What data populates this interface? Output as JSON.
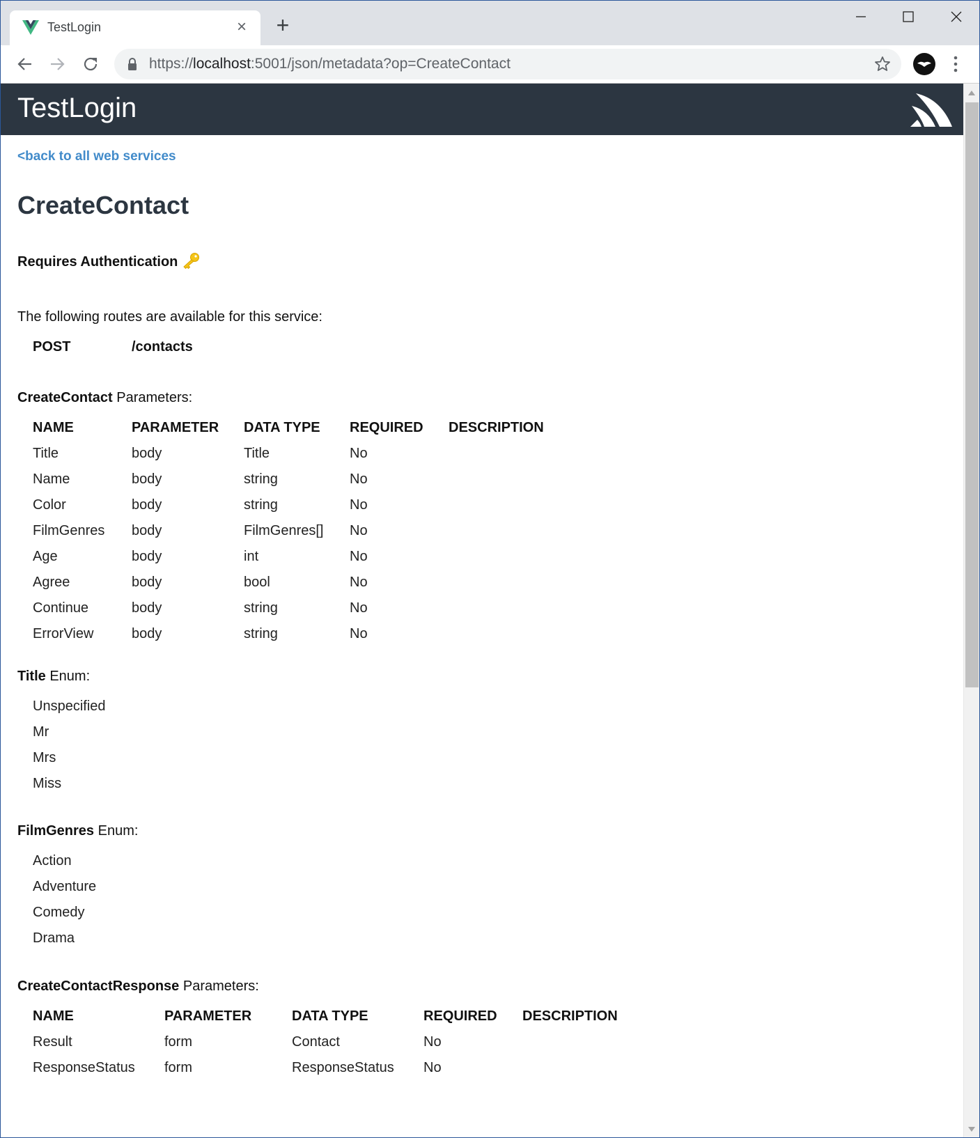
{
  "browser": {
    "tab_title": "TestLogin",
    "url_prefix": "https://",
    "url_host": "localhost",
    "url_rest": ":5001/json/metadata?op=CreateContact",
    "accent": "#2c3641"
  },
  "page": {
    "header_title": "TestLogin",
    "back_link": "<back to all web services",
    "title": "CreateContact",
    "auth_label": "Requires Authentication",
    "routes_intro": "The following routes are available for this service:",
    "route": {
      "verb": "POST",
      "path": "/contacts"
    }
  },
  "params": {
    "title_bold": "CreateContact",
    "title_rest": " Parameters:",
    "headers": [
      "NAME",
      "PARAMETER",
      "DATA TYPE",
      "REQUIRED",
      "DESCRIPTION"
    ],
    "rows": [
      [
        "Title",
        "body",
        "Title",
        "No",
        ""
      ],
      [
        "Name",
        "body",
        "string",
        "No",
        ""
      ],
      [
        "Color",
        "body",
        "string",
        "No",
        ""
      ],
      [
        "FilmGenres",
        "body",
        "FilmGenres[]",
        "No",
        ""
      ],
      [
        "Age",
        "body",
        "int",
        "No",
        ""
      ],
      [
        "Agree",
        "body",
        "bool",
        "No",
        ""
      ],
      [
        "Continue",
        "body",
        "string",
        "No",
        ""
      ],
      [
        "ErrorView",
        "body",
        "string",
        "No",
        ""
      ]
    ]
  },
  "title_enum": {
    "title_bold": "Title",
    "title_rest": " Enum:",
    "items": [
      "Unspecified",
      "Mr",
      "Mrs",
      "Miss"
    ]
  },
  "genres_enum": {
    "title_bold": "FilmGenres",
    "title_rest": " Enum:",
    "items": [
      "Action",
      "Adventure",
      "Comedy",
      "Drama"
    ]
  },
  "response": {
    "title_bold": "CreateContactResponse",
    "title_rest": " Parameters:",
    "headers": [
      "NAME",
      "PARAMETER",
      "DATA TYPE",
      "REQUIRED",
      "DESCRIPTION"
    ],
    "rows": [
      [
        "Result",
        "form",
        "Contact",
        "No",
        ""
      ],
      [
        "ResponseStatus",
        "form",
        "ResponseStatus",
        "No",
        ""
      ]
    ]
  }
}
